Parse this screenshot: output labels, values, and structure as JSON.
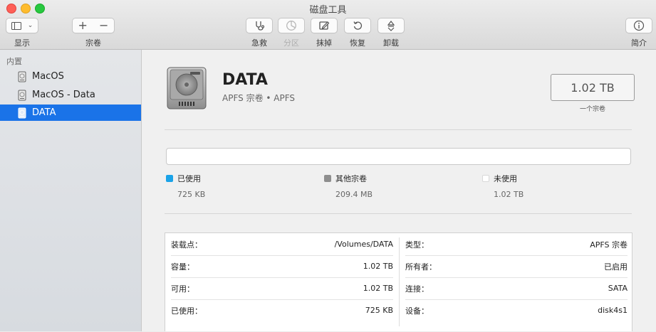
{
  "window": {
    "title": "磁盘工具"
  },
  "toolbar": {
    "view_label": "显示",
    "volume_label": "宗卷",
    "volume_add": "+",
    "volume_remove": "−",
    "first_aid_label": "急救",
    "partition_label": "分区",
    "erase_label": "抹掉",
    "restore_label": "恢复",
    "unmount_label": "卸载",
    "info_label": "简介"
  },
  "sidebar": {
    "section": "内置",
    "items": [
      {
        "label": "MacOS"
      },
      {
        "label": "MacOS - Data"
      },
      {
        "label": "DATA"
      }
    ]
  },
  "disk": {
    "name": "DATA",
    "subtitle": "APFS 宗卷 • APFS",
    "capacity": "1.02 TB",
    "capacity_caption": "一个宗卷"
  },
  "usage": {
    "legend": [
      {
        "name": "已使用",
        "value": "725 KB",
        "color": "#1aa3e8"
      },
      {
        "name": "其他宗卷",
        "value": "209.4 MB",
        "color": "#8e8e8e"
      },
      {
        "name": "未使用",
        "value": "1.02 TB",
        "color": "#ffffff"
      }
    ]
  },
  "info": {
    "left": [
      {
        "key": "装载点：",
        "value": "/Volumes/DATA"
      },
      {
        "key": "容量：",
        "value": "1.02 TB"
      },
      {
        "key": "可用：",
        "value": "1.02 TB"
      },
      {
        "key": "已使用：",
        "value": "725 KB"
      }
    ],
    "right": [
      {
        "key": "类型：",
        "value": "APFS 宗卷"
      },
      {
        "key": "所有者：",
        "value": "已启用"
      },
      {
        "key": "连接：",
        "value": "SATA"
      },
      {
        "key": "设备：",
        "value": "disk4s1"
      }
    ]
  }
}
